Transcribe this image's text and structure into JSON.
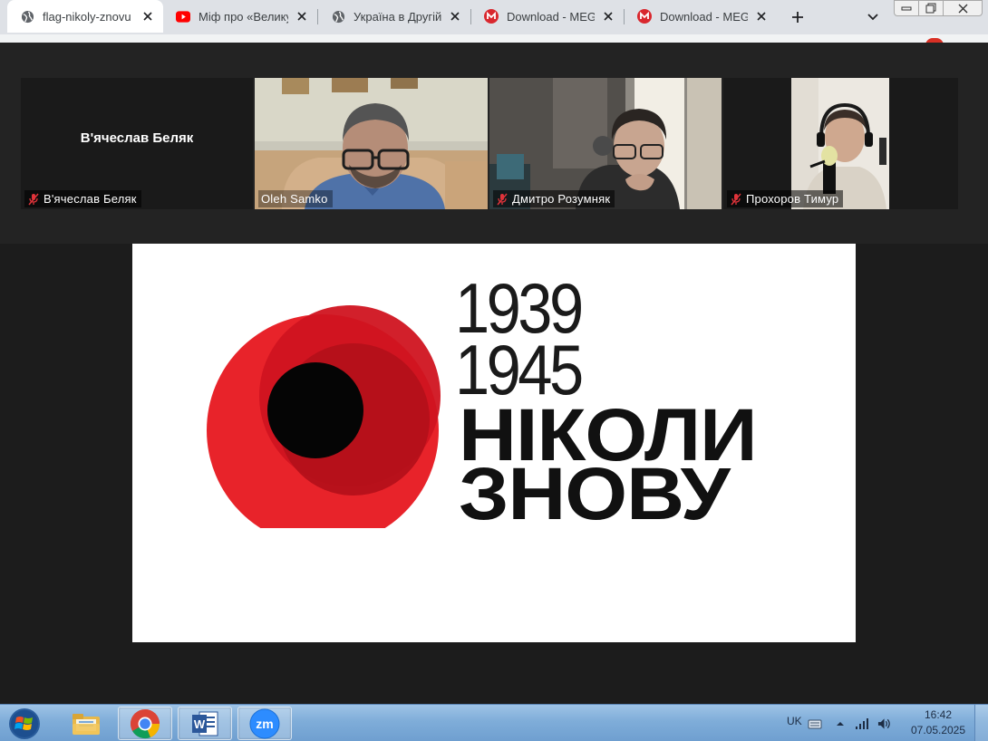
{
  "browser": {
    "tabs": [
      {
        "title": "flag-nikoly-znovu",
        "favicon": "globe-icon",
        "active": true
      },
      {
        "title": "Міф про «Велику",
        "favicon": "youtube-icon",
        "active": false
      },
      {
        "title": "Україна в Другій",
        "favicon": "globe-icon",
        "active": false
      },
      {
        "title": "Download - MEGA",
        "favicon": "mega-icon",
        "active": false
      },
      {
        "title": "Download - MEGA",
        "favicon": "mega-icon",
        "active": false
      }
    ],
    "new_tab_icon": "plus-icon",
    "tab_search_icon": "chevron-down-icon"
  },
  "meeting": {
    "participants": [
      {
        "name": "В'ячеслав Беляк",
        "display_name": "В'ячеслав Беляк",
        "video": false,
        "muted": true
      },
      {
        "name": "Oleh  Samko",
        "video": true,
        "muted": false
      },
      {
        "name": "Дмитро Розумняк",
        "video": true,
        "muted": true
      },
      {
        "name": "Прохоров Тимур",
        "video": true,
        "muted": true,
        "speaking": true
      }
    ],
    "speaking_color": "#e6f07a"
  },
  "slide": {
    "year_start": "1939",
    "year_end": "1945",
    "line1": "НІКОЛИ",
    "line2": "ЗНОВУ",
    "poppy_colors": [
      "#e8232a",
      "#c8101e",
      "#a50d18",
      "#000000"
    ]
  },
  "taskbar": {
    "apps": [
      {
        "name": "file-explorer",
        "icon": "folder-icon"
      },
      {
        "name": "chrome",
        "icon": "chrome-icon"
      },
      {
        "name": "word",
        "icon": "word-icon"
      },
      {
        "name": "zoom",
        "icon": "zoom-icon",
        "label": "zm"
      }
    ],
    "language": "UK",
    "time": "16:42",
    "date": "07.05.2025"
  }
}
